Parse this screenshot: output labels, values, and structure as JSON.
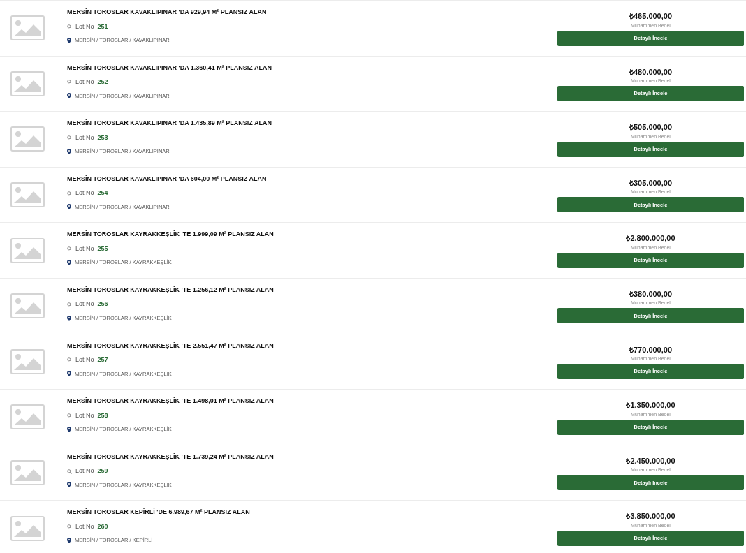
{
  "listings": [
    {
      "title": "MERSİN TOROSLAR KAVAKLIPINAR 'DA 929,94 M² PLANSIZ ALAN",
      "lot_label": "Lot No",
      "lot_number": "251",
      "location": "MERSİN / TOROSLAR / KAVAKLIPINAR",
      "price": "₺465.000,00",
      "price_label": "Muhammen Bedel",
      "button": "Detaylı İncele"
    },
    {
      "title": "MERSİN TOROSLAR KAVAKLIPINAR 'DA 1.360,41 M² PLANSIZ ALAN",
      "lot_label": "Lot No",
      "lot_number": "252",
      "location": "MERSİN / TOROSLAR / KAVAKLIPINAR",
      "price": "₺480.000,00",
      "price_label": "Muhammen Bedel",
      "button": "Detaylı İncele"
    },
    {
      "title": "MERSİN TOROSLAR KAVAKLIPINAR 'DA 1.435,89 M² PLANSIZ ALAN",
      "lot_label": "Lot No",
      "lot_number": "253",
      "location": "MERSİN / TOROSLAR / KAVAKLIPINAR",
      "price": "₺505.000,00",
      "price_label": "Muhammen Bedel",
      "button": "Detaylı İncele"
    },
    {
      "title": "MERSİN TOROSLAR KAVAKLIPINAR 'DA 604,00 M² PLANSIZ ALAN",
      "lot_label": "Lot No",
      "lot_number": "254",
      "location": "MERSİN / TOROSLAR / KAVAKLIPINAR",
      "price": "₺305.000,00",
      "price_label": "Muhammen Bedel",
      "button": "Detaylı İncele"
    },
    {
      "title": "MERSİN TOROSLAR KAYRAKKEŞLİK 'TE 1.999,09 M² PLANSIZ ALAN",
      "lot_label": "Lot No",
      "lot_number": "255",
      "location": "MERSİN / TOROSLAR / KAYRAKKEŞLİK",
      "price": "₺2.800.000,00",
      "price_label": "Muhammen Bedel",
      "button": "Detaylı İncele"
    },
    {
      "title": "MERSİN TOROSLAR KAYRAKKEŞLİK 'TE 1.256,12 M² PLANSIZ ALAN",
      "lot_label": "Lot No",
      "lot_number": "256",
      "location": "MERSİN / TOROSLAR / KAYRAKKEŞLİK",
      "price": "₺380.000,00",
      "price_label": "Muhammen Bedel",
      "button": "Detaylı İncele"
    },
    {
      "title": "MERSİN TOROSLAR KAYRAKKEŞLİK 'TE 2.551,47 M² PLANSIZ ALAN",
      "lot_label": "Lot No",
      "lot_number": "257",
      "location": "MERSİN / TOROSLAR / KAYRAKKEŞLİK",
      "price": "₺770.000,00",
      "price_label": "Muhammen Bedel",
      "button": "Detaylı İncele"
    },
    {
      "title": "MERSİN TOROSLAR KAYRAKKEŞLİK 'TE 1.498,01 M² PLANSIZ ALAN",
      "lot_label": "Lot No",
      "lot_number": "258",
      "location": "MERSİN / TOROSLAR / KAYRAKKEŞLİK",
      "price": "₺1.350.000,00",
      "price_label": "Muhammen Bedel",
      "button": "Detaylı İncele"
    },
    {
      "title": "MERSİN TOROSLAR KAYRAKKEŞLİK 'TE 1.739,24 M² PLANSIZ ALAN",
      "lot_label": "Lot No",
      "lot_number": "259",
      "location": "MERSİN / TOROSLAR / KAYRAKKEŞLİK",
      "price": "₺2.450.000,00",
      "price_label": "Muhammen Bedel",
      "button": "Detaylı İncele"
    },
    {
      "title": "MERSİN TOROSLAR KEPİRLİ 'DE 6.989,67 M² PLANSIZ ALAN",
      "lot_label": "Lot No",
      "lot_number": "260",
      "location": "MERSİN / TOROSLAR / KEPİRLİ",
      "price": "₺3.850.000,00",
      "price_label": "Muhammen Bedel",
      "button": "Detaylı İncele"
    }
  ]
}
